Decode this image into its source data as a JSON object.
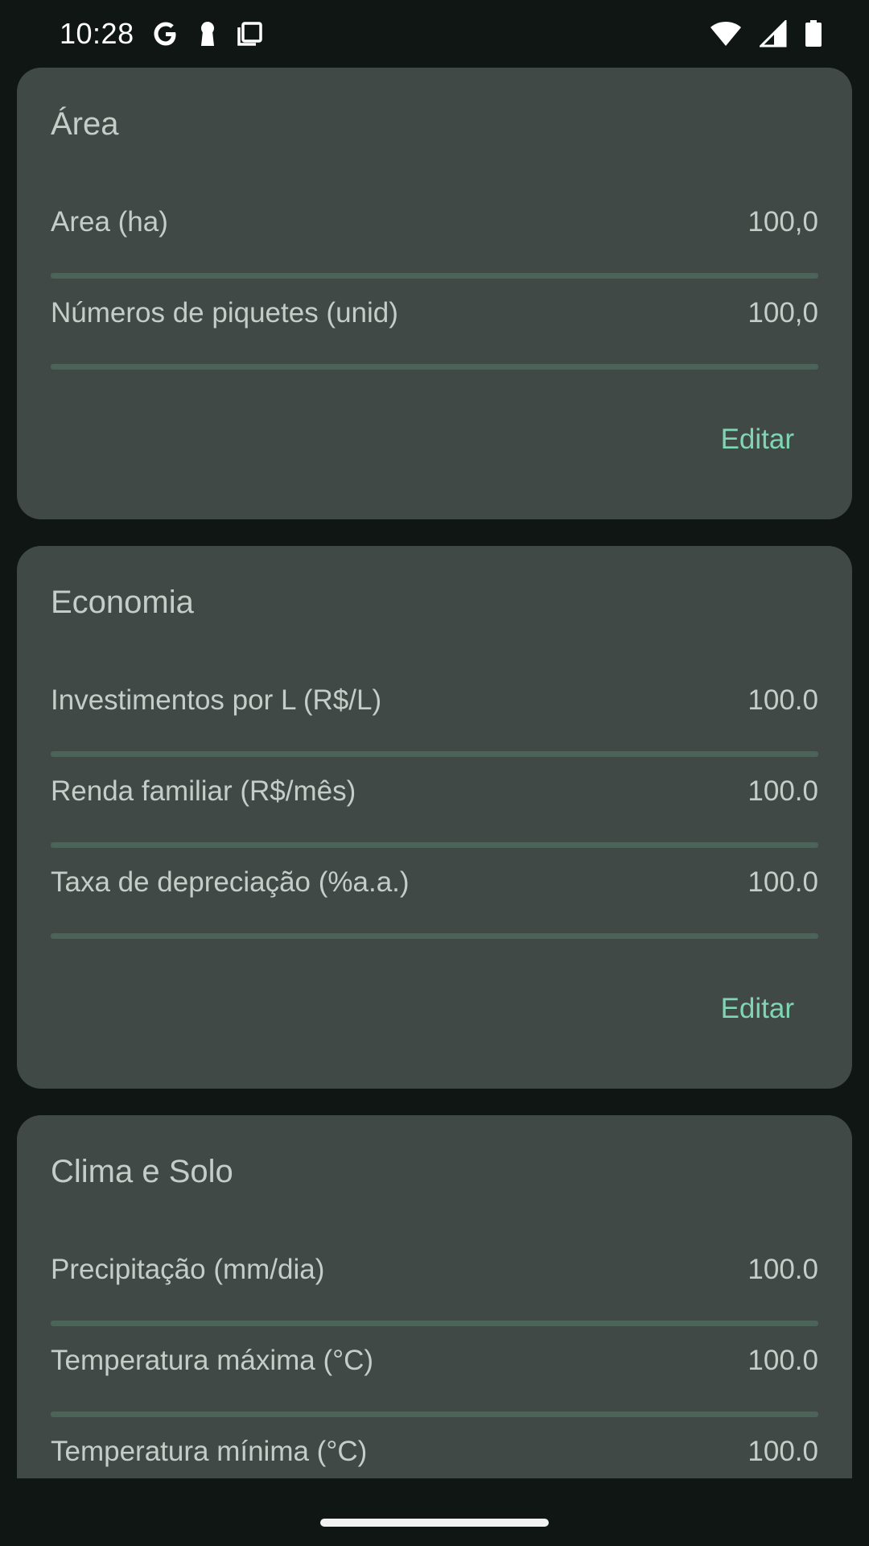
{
  "status_bar": {
    "time": "10:28",
    "icons_left": [
      "google-icon",
      "keyhole-icon",
      "copy-icon"
    ],
    "icons_right": [
      "wifi-icon",
      "cell-signal-icon",
      "battery-icon"
    ]
  },
  "cards": [
    {
      "title": "Área",
      "rows": [
        {
          "label": "Area (ha)",
          "value": "100,0"
        },
        {
          "label": "Números de piquetes (unid)",
          "value": "100,0"
        }
      ],
      "edit_label": "Editar"
    },
    {
      "title": "Economia",
      "rows": [
        {
          "label": "Investimentos por L (R$/L)",
          "value": "100.0"
        },
        {
          "label": "Renda familiar (R$/mês)",
          "value": "100.0"
        },
        {
          "label": "Taxa de depreciação (%a.a.)",
          "value": "100.0"
        }
      ],
      "edit_label": "Editar"
    },
    {
      "title": "Clima e Solo",
      "rows": [
        {
          "label": "Precipitação (mm/dia)",
          "value": "100.0"
        },
        {
          "label": "Temperatura máxima (°C)",
          "value": "100.0"
        },
        {
          "label": "Temperatura mínima (°C)",
          "value": "100.0"
        }
      ]
    }
  ],
  "colors": {
    "background": "#101614",
    "card": "#404946",
    "divider": "#4c6359",
    "accent": "#7fd6b5",
    "text": "#c6cdc9"
  }
}
